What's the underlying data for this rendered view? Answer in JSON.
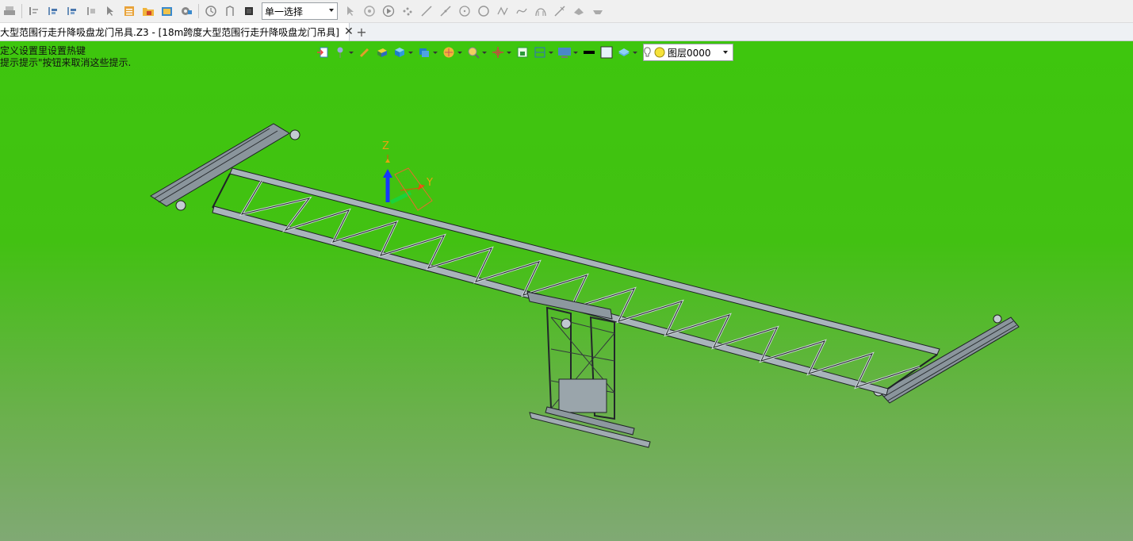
{
  "toolbar": {
    "select_mode": "单一选择"
  },
  "tabs": {
    "active_title": "大型范围行走升降吸盘龙门吊具.Z3 - [18m跨度大型范围行走升降吸盘龙门吊具]",
    "close_symbol": "✕",
    "new_tab_symbol": "+"
  },
  "hints": {
    "line1": "定义设置里设置热键",
    "line2": "提示提示\"按钮来取消这些提示."
  },
  "view_toolbar": {
    "layer_name": "图层0000"
  },
  "axes": {
    "z_label": "Z",
    "y_label": "Y"
  },
  "colors": {
    "viewport_top": "#3ec60e",
    "viewport_bottom": "#80a974",
    "steel": "#a9b4bb",
    "axis_z": "#1538ff",
    "axis_y": "#e84a0e"
  }
}
